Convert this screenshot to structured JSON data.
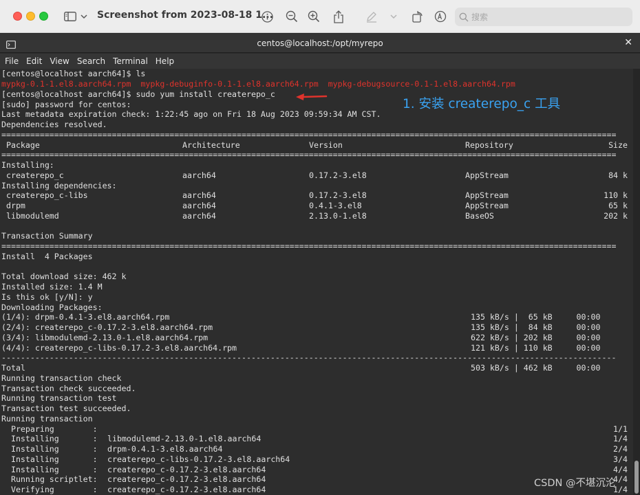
{
  "preview": {
    "title": "Screenshot from 2023-08-18 1...",
    "search_placeholder": "搜索",
    "toolbar_icons": [
      "sidebar-icon",
      "chevron-down-icon",
      "info-icon",
      "zoom-out-icon",
      "zoom-in-icon",
      "share-icon",
      "markup-pen-icon",
      "chevron-down-icon",
      "rotate-icon",
      "markup-circle-icon",
      "search-icon"
    ]
  },
  "terminal": {
    "title": "centos@localhost:/opt/myrepo",
    "menu": [
      "File",
      "Edit",
      "View",
      "Search",
      "Terminal",
      "Help"
    ],
    "prompt1": "[centos@localhost aarch64]$ ls",
    "ls_output": "mypkg-0.1-1.el8.aarch64.rpm  mypkg-debuginfo-0.1-1.el8.aarch64.rpm  mypkg-debugsource-0.1-1.el8.aarch64.rpm",
    "prompt2": "[centos@localhost aarch64]$ sudo yum install createrepo_c",
    "sudo_prompt": "[sudo] password for centos:",
    "metadata": "Last metadata expiration check: 1:22:45 ago on Fri 18 Aug 2023 09:59:34 AM CST.",
    "deps_resolved": "Dependencies resolved.",
    "double_rule": "================================================================================================================================",
    "dash_rule": "--------------------------------------------------------------------------------------------------------------------------------",
    "header": {
      "package": " Package",
      "arch": "Architecture",
      "version": "Version",
      "repo": "Repository",
      "size": "Size"
    },
    "installing_label": "Installing:",
    "installing_deps_label": "Installing dependencies:",
    "packages": [
      {
        "name": " createrepo_c",
        "arch": "aarch64",
        "version": "0.17.2-3.el8",
        "repo": "AppStream",
        "size": "84 k"
      },
      {
        "name": " createrepo_c-libs",
        "arch": "aarch64",
        "version": "0.17.2-3.el8",
        "repo": "AppStream",
        "size": "110 k"
      },
      {
        "name": " drpm",
        "arch": "aarch64",
        "version": "0.4.1-3.el8",
        "repo": "AppStream",
        "size": "65 k"
      },
      {
        "name": " libmodulemd",
        "arch": "aarch64",
        "version": "2.13.0-1.el8",
        "repo": "BaseOS",
        "size": "202 k"
      }
    ],
    "transaction_summary": "Transaction Summary",
    "install_count": "Install  4 Packages",
    "total_download": "Total download size: 462 k",
    "installed_size": "Installed size: 1.4 M",
    "confirm": "Is this ok [y/N]: y",
    "downloading": "Downloading Packages:",
    "downloads": [
      {
        "file": "(1/4): drpm-0.4.1-3.el8.aarch64.rpm",
        "stats": "135 kB/s |  65 kB     00:00"
      },
      {
        "file": "(2/4): createrepo_c-0.17.2-3.el8.aarch64.rpm",
        "stats": "135 kB/s |  84 kB     00:00"
      },
      {
        "file": "(3/4): libmodulemd-2.13.0-1.el8.aarch64.rpm",
        "stats": "622 kB/s | 202 kB     00:00"
      },
      {
        "file": "(4/4): createrepo_c-libs-0.17.2-3.el8.aarch64.rpm",
        "stats": "121 kB/s | 110 kB     00:00"
      }
    ],
    "total_label": "Total",
    "total_stats": "503 kB/s | 462 kB     00:00",
    "tail_lines": [
      "Running transaction check",
      "Transaction check succeeded.",
      "Running transaction test",
      "Transaction test succeeded.",
      "Running transaction"
    ],
    "steps": [
      {
        "action": "  Preparing        :",
        "target": "",
        "count": "1/1"
      },
      {
        "action": "  Installing       :",
        "target": "libmodulemd-2.13.0-1.el8.aarch64",
        "count": "1/4"
      },
      {
        "action": "  Installing       :",
        "target": "drpm-0.4.1-3.el8.aarch64",
        "count": "2/4"
      },
      {
        "action": "  Installing       :",
        "target": "createrepo_c-libs-0.17.2-3.el8.aarch64",
        "count": "3/4"
      },
      {
        "action": "  Installing       :",
        "target": "createrepo_c-0.17.2-3.el8.aarch64",
        "count": "4/4"
      },
      {
        "action": "  Running scriptlet:",
        "target": "createrepo_c-0.17.2-3.el8.aarch64",
        "count": "4/4"
      },
      {
        "action": "  Verifying        :",
        "target": "createrepo_c-0.17.2-3.el8.aarch64",
        "count": "1/4"
      }
    ]
  },
  "annotation": "1. 安装 createrepo_c 工具",
  "watermark": "CSDN @不堪沉沦",
  "colors": {
    "annotation": "#3aa3f2",
    "ls_output": "#e0332c",
    "arrow": "#e0332c"
  }
}
